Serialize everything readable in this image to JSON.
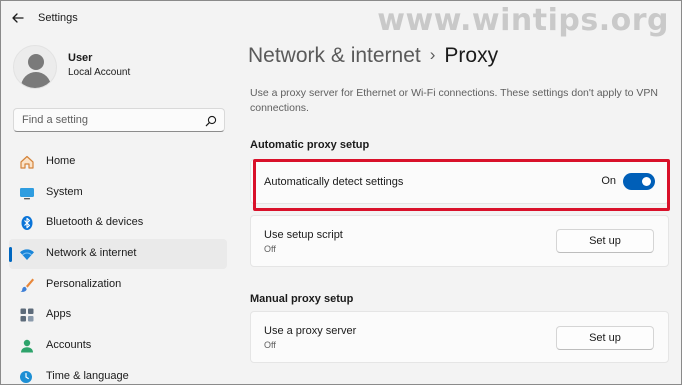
{
  "window": {
    "title": "Settings",
    "watermark": "www.wintips.org"
  },
  "user": {
    "name": "User",
    "account_type": "Local Account"
  },
  "search": {
    "placeholder": "Find a setting"
  },
  "nav": {
    "items": [
      {
        "label": "Home",
        "icon": "home-icon"
      },
      {
        "label": "System",
        "icon": "system-icon"
      },
      {
        "label": "Bluetooth & devices",
        "icon": "bluetooth-icon"
      },
      {
        "label": "Network & internet",
        "icon": "network-icon",
        "active": true
      },
      {
        "label": "Personalization",
        "icon": "personalization-icon"
      },
      {
        "label": "Apps",
        "icon": "apps-icon"
      },
      {
        "label": "Accounts",
        "icon": "accounts-icon"
      },
      {
        "label": "Time & language",
        "icon": "time-language-icon"
      }
    ]
  },
  "breadcrumb": {
    "parent": "Network & internet",
    "separator": "›",
    "current": "Proxy"
  },
  "description": "Use a proxy server for Ethernet or Wi-Fi connections. These settings don't apply to VPN connections.",
  "automatic": {
    "title": "Automatic proxy setup",
    "detect": {
      "label": "Automatically detect settings",
      "state": "On",
      "enabled": true
    },
    "script": {
      "label": "Use setup script",
      "status": "Off",
      "button": "Set up"
    }
  },
  "manual": {
    "title": "Manual proxy setup",
    "proxy": {
      "label": "Use a proxy server",
      "status": "Off",
      "button": "Set up"
    }
  },
  "colors": {
    "accent": "#005fb8",
    "highlight": "#d9112a",
    "background": "#f3f3f3"
  }
}
